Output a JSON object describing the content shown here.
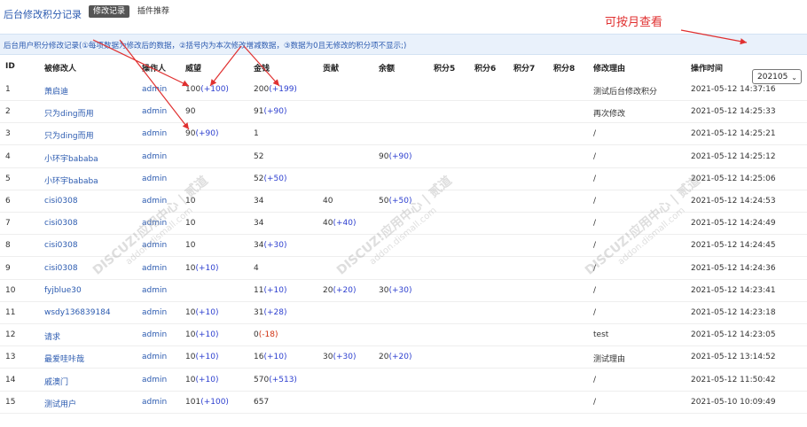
{
  "header": {
    "title": "后台修改积分记录",
    "tabs": [
      {
        "label": "修改记录",
        "active": true
      },
      {
        "label": "插件推荐",
        "active": false
      }
    ],
    "annotation": "可按月查看"
  },
  "notice": "后台用户积分修改记录(①每项数据为修改后的数据，②括号内为本次修改增减数据，③数据为0且无修改的积分项不显示;)",
  "month_select": {
    "value": "202105"
  },
  "columns": [
    "ID",
    "被修改人",
    "操作人",
    "威望",
    "金钱",
    "贡献",
    "余额",
    "积分5",
    "积分6",
    "积分7",
    "积分8",
    "修改理由",
    "操作时间"
  ],
  "rows": [
    {
      "id": "1",
      "user": "萧启迪",
      "operator": "admin",
      "c1": {
        "v": "100",
        "d": "(+100)"
      },
      "c2": {
        "v": "200",
        "d": "(+199)"
      },
      "c3": {
        "v": "",
        "d": ""
      },
      "c4": {
        "v": "",
        "d": ""
      },
      "reason": "测试后台修改积分",
      "time": "2021-05-12 14:37:16"
    },
    {
      "id": "2",
      "user": "只为ding而用",
      "operator": "admin",
      "c1": {
        "v": "90",
        "d": ""
      },
      "c2": {
        "v": "91",
        "d": "(+90)"
      },
      "c3": {
        "v": "",
        "d": ""
      },
      "c4": {
        "v": "",
        "d": ""
      },
      "reason": "再次修改",
      "time": "2021-05-12 14:25:33"
    },
    {
      "id": "3",
      "user": "只为ding而用",
      "operator": "admin",
      "c1": {
        "v": "90",
        "d": "(+90)"
      },
      "c2": {
        "v": "1",
        "d": ""
      },
      "c3": {
        "v": "",
        "d": ""
      },
      "c4": {
        "v": "",
        "d": ""
      },
      "reason": "/",
      "time": "2021-05-12 14:25:21"
    },
    {
      "id": "4",
      "user": "小环宇bababa",
      "operator": "admin",
      "c1": {
        "v": "",
        "d": ""
      },
      "c2": {
        "v": "52",
        "d": ""
      },
      "c3": {
        "v": "",
        "d": ""
      },
      "c4": {
        "v": "90",
        "d": "(+90)"
      },
      "reason": "/",
      "time": "2021-05-12 14:25:12"
    },
    {
      "id": "5",
      "user": "小环宇bababa",
      "operator": "admin",
      "c1": {
        "v": "",
        "d": ""
      },
      "c2": {
        "v": "52",
        "d": "(+50)"
      },
      "c3": {
        "v": "",
        "d": ""
      },
      "c4": {
        "v": "",
        "d": ""
      },
      "reason": "/",
      "time": "2021-05-12 14:25:06"
    },
    {
      "id": "6",
      "user": "cisi0308",
      "operator": "admin",
      "c1": {
        "v": "10",
        "d": ""
      },
      "c2": {
        "v": "34",
        "d": ""
      },
      "c3": {
        "v": "40",
        "d": ""
      },
      "c4": {
        "v": "50",
        "d": "(+50)"
      },
      "reason": "/",
      "time": "2021-05-12 14:24:53"
    },
    {
      "id": "7",
      "user": "cisi0308",
      "operator": "admin",
      "c1": {
        "v": "10",
        "d": ""
      },
      "c2": {
        "v": "34",
        "d": ""
      },
      "c3": {
        "v": "40",
        "d": "(+40)"
      },
      "c4": {
        "v": "",
        "d": ""
      },
      "reason": "/",
      "time": "2021-05-12 14:24:49"
    },
    {
      "id": "8",
      "user": "cisi0308",
      "operator": "admin",
      "c1": {
        "v": "10",
        "d": ""
      },
      "c2": {
        "v": "34",
        "d": "(+30)"
      },
      "c3": {
        "v": "",
        "d": ""
      },
      "c4": {
        "v": "",
        "d": ""
      },
      "reason": "/",
      "time": "2021-05-12 14:24:45"
    },
    {
      "id": "9",
      "user": "cisi0308",
      "operator": "admin",
      "c1": {
        "v": "10",
        "d": "(+10)"
      },
      "c2": {
        "v": "4",
        "d": ""
      },
      "c3": {
        "v": "",
        "d": ""
      },
      "c4": {
        "v": "",
        "d": ""
      },
      "reason": "/",
      "time": "2021-05-12 14:24:36"
    },
    {
      "id": "10",
      "user": "fyjblue30",
      "operator": "admin",
      "c1": {
        "v": "",
        "d": ""
      },
      "c2": {
        "v": "11",
        "d": "(+10)"
      },
      "c3": {
        "v": "20",
        "d": "(+20)"
      },
      "c4": {
        "v": "30",
        "d": "(+30)"
      },
      "reason": "/",
      "time": "2021-05-12 14:23:41"
    },
    {
      "id": "11",
      "user": "wsdy136839184",
      "operator": "admin",
      "c1": {
        "v": "10",
        "d": "(+10)"
      },
      "c2": {
        "v": "31",
        "d": "(+28)"
      },
      "c3": {
        "v": "",
        "d": ""
      },
      "c4": {
        "v": "",
        "d": ""
      },
      "reason": "/",
      "time": "2021-05-12 14:23:18"
    },
    {
      "id": "12",
      "user": "请求",
      "operator": "admin",
      "c1": {
        "v": "10",
        "d": "(+10)"
      },
      "c2": {
        "v": "0",
        "d": "(-18)"
      },
      "c3": {
        "v": "",
        "d": ""
      },
      "c4": {
        "v": "",
        "d": ""
      },
      "reason": "test",
      "time": "2021-05-12 14:23:05"
    },
    {
      "id": "13",
      "user": "最爱哇咔哉",
      "operator": "admin",
      "c1": {
        "v": "10",
        "d": "(+10)"
      },
      "c2": {
        "v": "16",
        "d": "(+10)"
      },
      "c3": {
        "v": "30",
        "d": "(+30)"
      },
      "c4": {
        "v": "20",
        "d": "(+20)"
      },
      "reason": "测试理由",
      "time": "2021-05-12 13:14:52"
    },
    {
      "id": "14",
      "user": "戚澳门",
      "operator": "admin",
      "c1": {
        "v": "10",
        "d": "(+10)"
      },
      "c2": {
        "v": "570",
        "d": "(+513)"
      },
      "c3": {
        "v": "",
        "d": ""
      },
      "c4": {
        "v": "",
        "d": ""
      },
      "reason": "/",
      "time": "2021-05-12 11:50:42"
    },
    {
      "id": "15",
      "user": "测试用户",
      "operator": "admin",
      "c1": {
        "v": "101",
        "d": "(+100)"
      },
      "c2": {
        "v": "657",
        "d": ""
      },
      "c3": {
        "v": "",
        "d": ""
      },
      "c4": {
        "v": "",
        "d": ""
      },
      "reason": "/",
      "time": "2021-05-10 10:09:49"
    }
  ],
  "watermark": {
    "main": "DISCUZ!应用中心 | 贰道",
    "sub": "addon.dismall.com"
  },
  "colors": {
    "link": "#2c5bb0",
    "positive": "#2d3fcf",
    "negative": "#d03010",
    "annotation": "#e03030",
    "infobar": "#e9f1fb"
  }
}
